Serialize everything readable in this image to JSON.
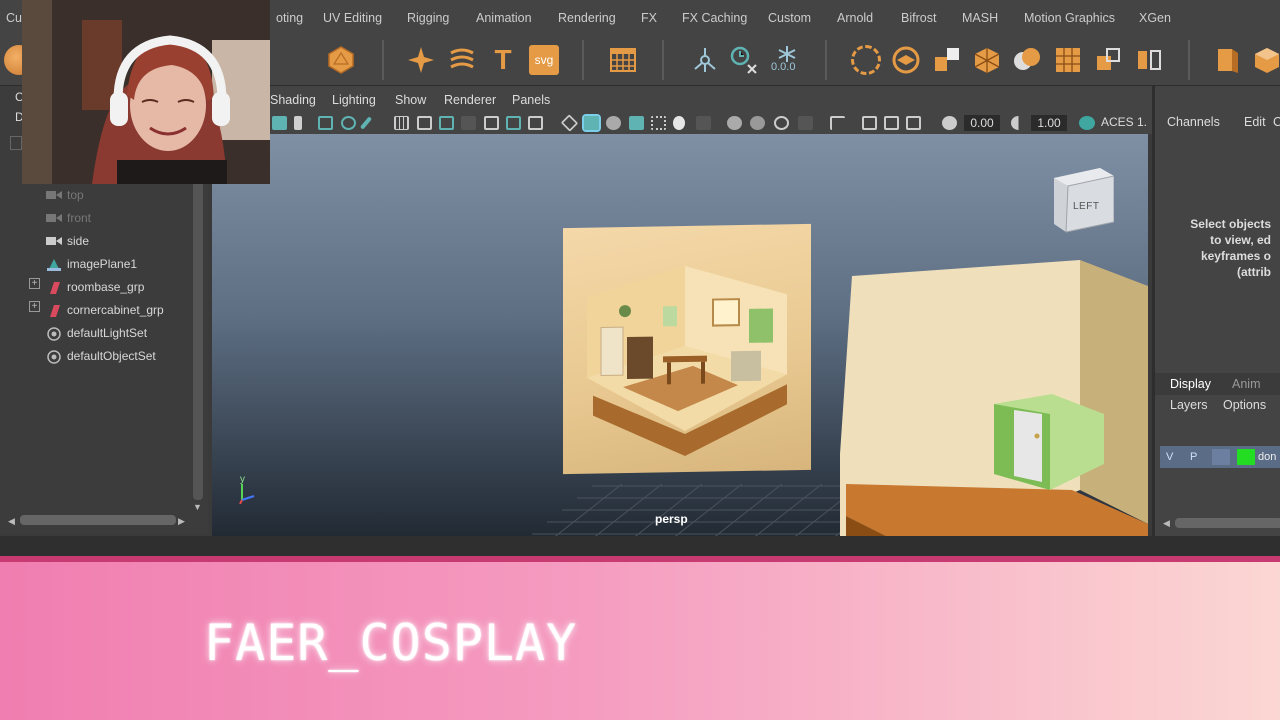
{
  "menubar": {
    "items": [
      "Cu",
      "oting",
      "UV Editing",
      "Rigging",
      "Animation",
      "Rendering",
      "FX",
      "FX Caching",
      "Custom",
      "Arnold",
      "Bifrost",
      "MASH",
      "Motion Graphics",
      "XGen"
    ]
  },
  "shelf": {
    "icons": [
      "sphere-icon",
      "polyhedron-icon",
      "sparkle-icon",
      "sweep-icon",
      "text-icon",
      "svg-icon",
      "grid-icon",
      "pivot-icon",
      "delete-history-icon",
      "freeze-icon",
      "lasso-icon",
      "bevel-icon",
      "combine-icon",
      "extrude-icon",
      "boolean-icon",
      "subdivide-icon",
      "duplicate-icon",
      "mirror-icon",
      "cube-icon",
      "cube2-icon"
    ],
    "svg_label": "svg",
    "text_label": "T",
    "freeze_value": "0.0.0"
  },
  "outliner": {
    "header_letters": [
      "C",
      "D"
    ],
    "items": [
      {
        "label": "top",
        "dim": true,
        "icon": "camera-icon"
      },
      {
        "label": "front",
        "dim": true,
        "icon": "camera-icon"
      },
      {
        "label": "side",
        "dim": false,
        "icon": "camera-icon"
      },
      {
        "label": "imagePlane1",
        "dim": false,
        "icon": "image-plane-icon"
      },
      {
        "label": "roombase_grp",
        "dim": false,
        "icon": "group-icon"
      },
      {
        "label": "cornercabinet_grp",
        "dim": false,
        "icon": "group-icon"
      },
      {
        "label": "defaultLightSet",
        "dim": false,
        "icon": "set-icon"
      },
      {
        "label": "defaultObjectSet",
        "dim": false,
        "icon": "set-icon"
      }
    ]
  },
  "viewport": {
    "menu": [
      "Shading",
      "Lighting",
      "Show",
      "Renderer",
      "Panels"
    ],
    "exposure": "0.00",
    "gamma": "1.00",
    "colorspace": "ACES 1.",
    "camera_label": "persp",
    "viewcube_label": "LEFT",
    "axis_label": "y"
  },
  "channel_box": {
    "menu": [
      "Channels",
      "Edit",
      "C"
    ],
    "hint_lines": [
      "Select objects",
      "to view, ed",
      "keyframes o",
      "(attrib"
    ],
    "tabs": [
      "Display",
      "Anim"
    ],
    "subtabs": [
      "Layers",
      "Options"
    ],
    "layer_buttons": [
      "V",
      "P"
    ],
    "layer_name": "don"
  },
  "overlay": {
    "brand": "FAER_COSPLAY"
  },
  "colors": {
    "banner_start": "#f07eb0",
    "banner_end": "#fbd7d3",
    "banner_border": "#c83a72",
    "shelf_orange": "#e59a45",
    "shelf_teal": "#5fb3b3",
    "layer_green": "#22dd22"
  }
}
